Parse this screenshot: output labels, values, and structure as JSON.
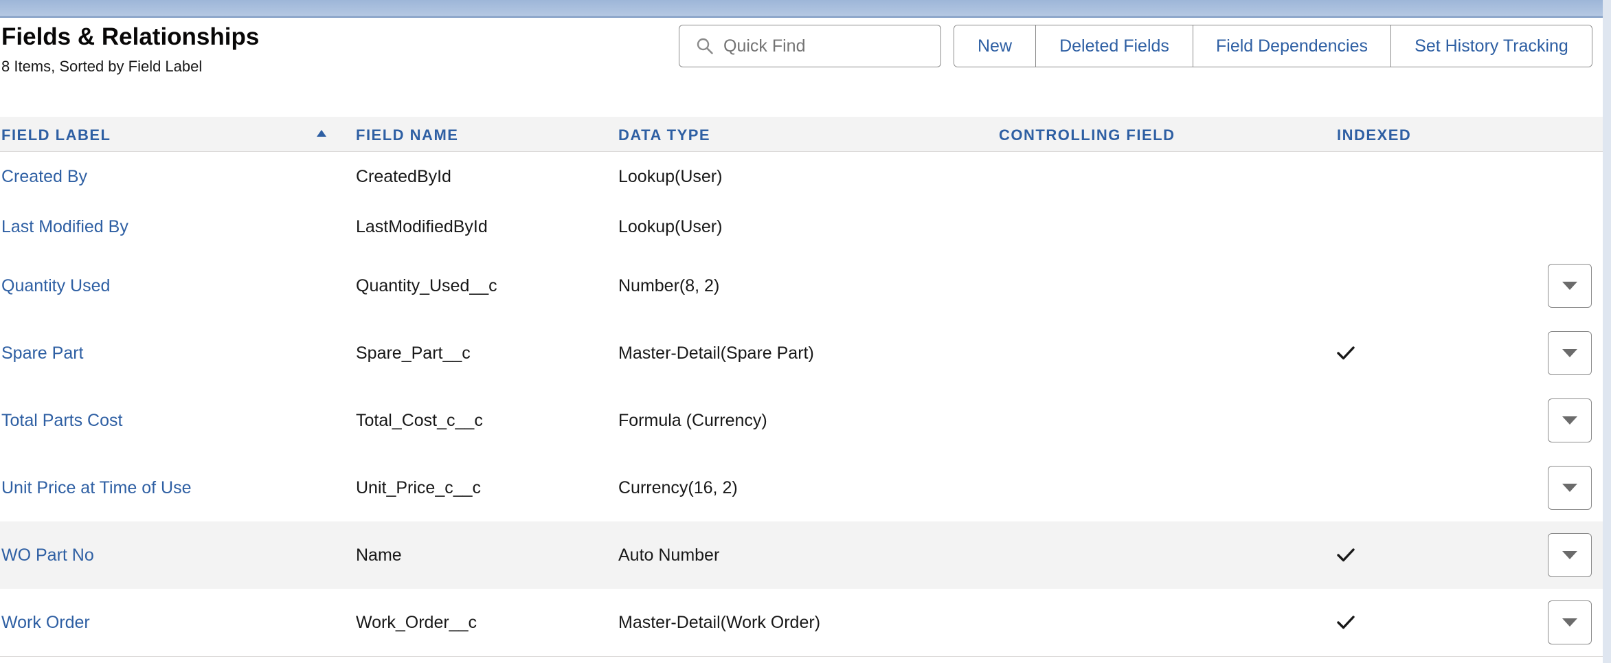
{
  "page": {
    "title": "Fields & Relationships",
    "subtitle": "8 Items, Sorted by Field Label"
  },
  "search": {
    "placeholder": "Quick Find",
    "value": ""
  },
  "toolbar": {
    "new_label": "New",
    "deleted_fields_label": "Deleted Fields",
    "field_dependencies_label": "Field Dependencies",
    "history_tracking_label": "Set History Tracking"
  },
  "table": {
    "columns": {
      "field_label": "Field Label",
      "field_name": "Field Name",
      "data_type": "Data Type",
      "controlling_field": "Controlling Field",
      "indexed": "Indexed"
    },
    "sort": {
      "column": "field_label",
      "direction": "ascending"
    },
    "rows": [
      {
        "field_label": "Created By",
        "field_name": "CreatedById",
        "data_type": "Lookup(User)",
        "controlling_field": "",
        "indexed": false,
        "has_actions": false
      },
      {
        "field_label": "Last Modified By",
        "field_name": "LastModifiedById",
        "data_type": "Lookup(User)",
        "controlling_field": "",
        "indexed": false,
        "has_actions": false
      },
      {
        "field_label": "Quantity Used",
        "field_name": "Quantity_Used__c",
        "data_type": "Number(8, 2)",
        "controlling_field": "",
        "indexed": false,
        "has_actions": true
      },
      {
        "field_label": "Spare Part",
        "field_name": "Spare_Part__c",
        "data_type": "Master-Detail(Spare Part)",
        "controlling_field": "",
        "indexed": true,
        "has_actions": true
      },
      {
        "field_label": "Total Parts Cost",
        "field_name": "Total_Cost_c__c",
        "data_type": "Formula (Currency)",
        "controlling_field": "",
        "indexed": false,
        "has_actions": true
      },
      {
        "field_label": "Unit Price at Time of Use",
        "field_name": "Unit_Price_c__c",
        "data_type": "Currency(16, 2)",
        "controlling_field": "",
        "indexed": false,
        "has_actions": true
      },
      {
        "field_label": "WO Part No",
        "field_name": "Name",
        "data_type": "Auto Number",
        "controlling_field": "",
        "indexed": true,
        "has_actions": true,
        "highlighted": true
      },
      {
        "field_label": "Work Order",
        "field_name": "Work_Order__c",
        "data_type": "Master-Detail(Work Order)",
        "controlling_field": "",
        "indexed": true,
        "has_actions": true
      }
    ]
  },
  "icons": {
    "search": "search-icon",
    "sort": "sort-ascending-icon",
    "indexed": "checkmark-icon",
    "row_actions": "chevron-down-icon"
  },
  "colors": {
    "link": "#2e5fa3",
    "header_bg": "#f3f3f3",
    "border": "#dddbda",
    "banner": "#b7cae4"
  }
}
